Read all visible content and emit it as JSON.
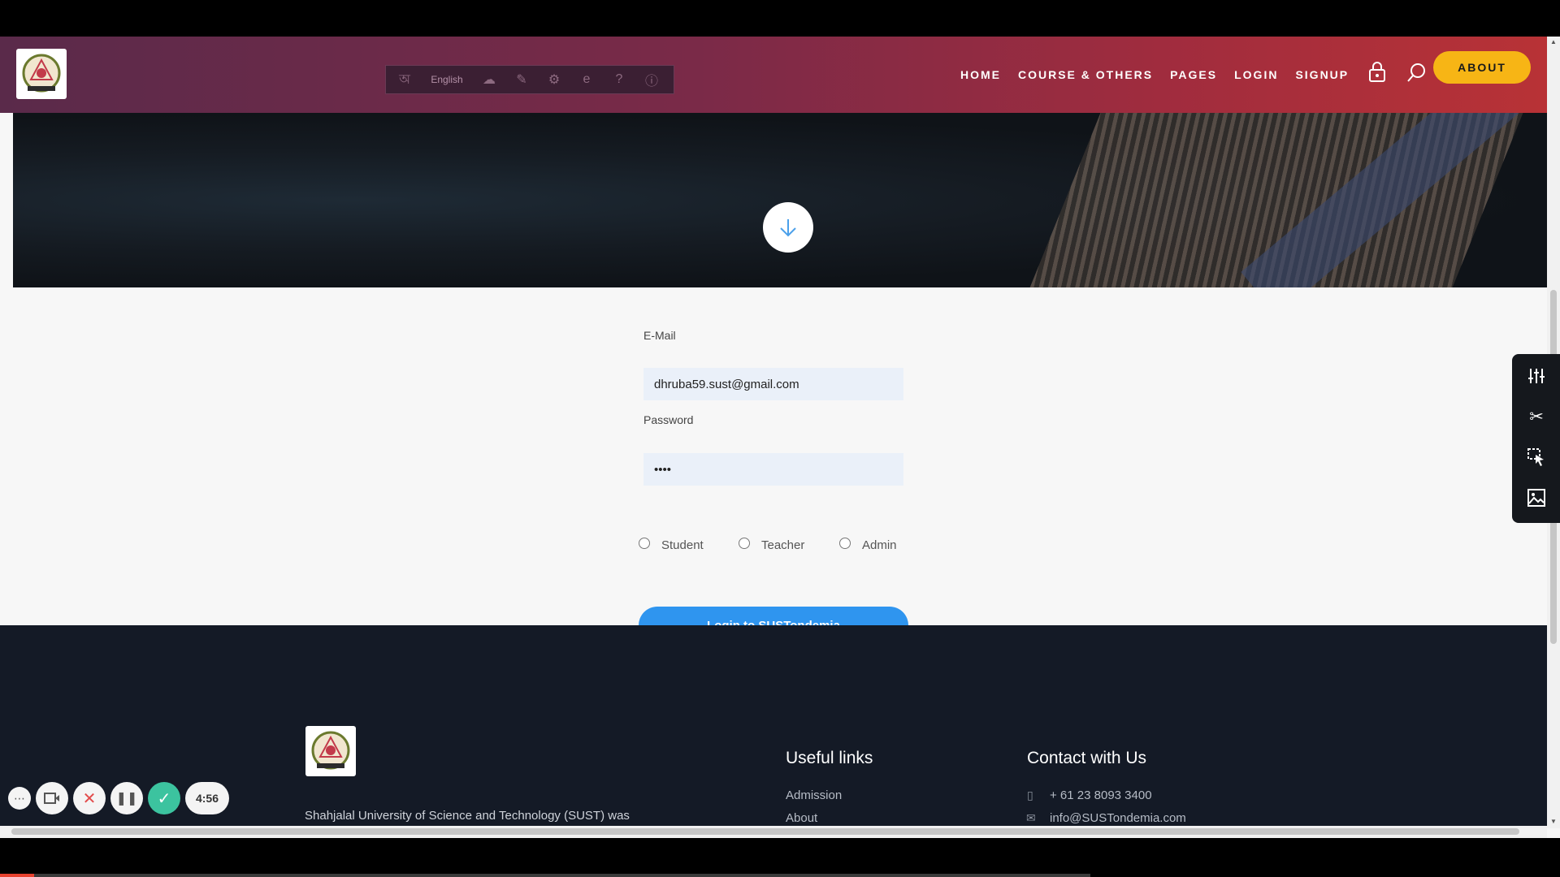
{
  "header": {
    "lang_label": "English",
    "nav": [
      "HOME",
      "COURSE & OTHERS",
      "PAGES",
      "LOGIN",
      "SIGNUP"
    ],
    "about_label": "ABOUT"
  },
  "form": {
    "email_label": "E-Mail",
    "email_value": "dhruba59.sust@gmail.com",
    "password_label": "Password",
    "password_value": "••••",
    "roles": [
      "Student",
      "Teacher",
      "Admin"
    ],
    "login_label": "Login to SUSTondemia"
  },
  "footer": {
    "description": "Shahjalal University of Science and Technology (SUST) was",
    "useful_links_title": "Useful links",
    "useful_links": [
      "Admission",
      "About"
    ],
    "contact_title": "Contact with Us",
    "phone": "+ 61 23 8093 3400",
    "email": "info@SUSTondemia.com"
  },
  "recorder": {
    "timer": "4:56"
  },
  "colors": {
    "accent_blue": "#2f95ef",
    "about_yellow": "#f7b515",
    "footer_bg": "#141a26",
    "confirm_green": "#3cc39f"
  }
}
